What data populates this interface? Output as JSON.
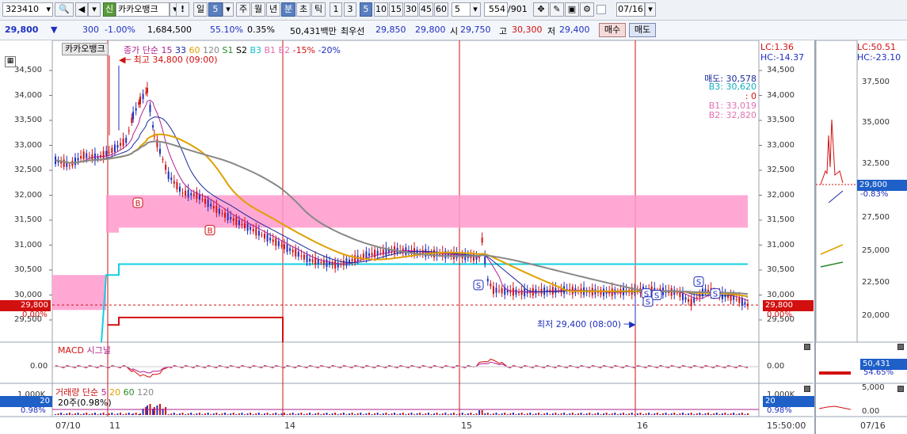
{
  "toolbar": {
    "code": "323410",
    "type_badge": "신",
    "stock_name": "카카오뱅크",
    "warn": "!",
    "period_day": "일",
    "period_value": "5",
    "periods": [
      "주",
      "월",
      "년",
      "분",
      "초",
      "틱"
    ],
    "minutes": [
      "1",
      "3",
      "5",
      "10",
      "15",
      "30",
      "45",
      "60"
    ],
    "count_input": "5",
    "count_display": "554",
    "count_total": "/901",
    "date": "07/16"
  },
  "quote": {
    "price": "29,800",
    "arrow": "▼",
    "change": "300",
    "change_pct": "-1.00%",
    "volume": "1,684,500",
    "vol_ratio": "55.10%",
    "turnover_pct": "0.35%",
    "amount": "50,431백만",
    "best_label": "최우선",
    "bid1": "29,850",
    "bid2": "29,800",
    "open_label": "시",
    "open": "29,750",
    "high_label": "고",
    "high": "30,300",
    "low_label": "저",
    "low": "29,400",
    "buy_btn": "매수",
    "sell_btn": "매도"
  },
  "main_chart": {
    "stock_tag": "카카오뱅크",
    "legend_items": [
      {
        "text": "종가 단순",
        "color": "#b02090"
      },
      {
        "text": "15",
        "color": "#b02090"
      },
      {
        "text": "33",
        "color": "#1a2a9a"
      },
      {
        "text": "60",
        "color": "#e0a000"
      },
      {
        "text": "120",
        "color": "#888888"
      },
      {
        "text": "S1",
        "color": "#2a8a2a"
      },
      {
        "text": "S2",
        "color": "#000000"
      },
      {
        "text": "B3",
        "color": "#10c0d0"
      },
      {
        "text": "B1",
        "color": "#e070b0"
      },
      {
        "text": "B2",
        "color": "#e070b0"
      },
      {
        "text": "-15%",
        "color": "#d21010"
      },
      {
        "text": "-20%",
        "color": "#1e2fbf"
      }
    ],
    "lc_left": "LC:1.36",
    "hc_left": "HC:-14.37",
    "lc_right": "LC:50.51",
    "hc_right": "HC:-23.10",
    "high_note": "최고 34,800 (09:00)",
    "low_note": "최저 29,400 (08:00)",
    "info_lines": [
      {
        "text": "매도: 30,578",
        "color": "#1a2a9a"
      },
      {
        "text": "B3: 30,620",
        "color": "#10b0c0"
      },
      {
        "text": ": 0",
        "color": "#d21010"
      },
      {
        "text": "B1: 33,019",
        "color": "#e070b0"
      },
      {
        "text": "B2: 32,820",
        "color": "#e070b0"
      }
    ],
    "y_labels": [
      "34,500",
      "34,000",
      "33,500",
      "33,000",
      "32,500",
      "32,000",
      "31,500",
      "31,000",
      "30,500",
      "30,000",
      "29,500"
    ],
    "y_labels_right_extra": [
      "34,500",
      "34,000",
      "33,500",
      "33,000",
      "32,500",
      "32,000",
      "31,500",
      "31,000",
      "30,500",
      "30,000",
      "29,500"
    ],
    "current_price_tag": "29,800",
    "current_pct_tag": "0.00%",
    "far_right_y": [
      "37,500",
      "35,000",
      "32,500",
      "27,500",
      "25,000",
      "22,500",
      "20,000"
    ],
    "far_right_price": "29,800",
    "far_right_pct": "-0.83%",
    "buy_marker": "B",
    "sell_marker": "S"
  },
  "macd_pane": {
    "legend_macd": "MACD",
    "legend_signal": "시그널",
    "zero_label": "0.00",
    "zero_label_right": "0.00",
    "right_values": [
      "50,431",
      "54.65%"
    ]
  },
  "volume_pane": {
    "legend_title": "거래량 단순",
    "legend_items": [
      {
        "text": "5",
        "color": "#b02090"
      },
      {
        "text": "20",
        "color": "#e0a000"
      },
      {
        "text": "60",
        "color": "#2a8a2a"
      },
      {
        "text": "120",
        "color": "#888888"
      }
    ],
    "sub_text": "20주(0.98%)",
    "y_top": "1,000K",
    "tag_value": "20",
    "tag_pct": "0.98%",
    "right_y_top": "1,000K",
    "right_tag_value": "20",
    "right_tag_pct": "0.98%",
    "far_right_y": [
      "5,000",
      "0.00"
    ]
  },
  "x_axis": {
    "labels": [
      "07/10",
      "11",
      "14",
      "15",
      "16"
    ],
    "time_label": "15:50:00",
    "far_right_label": "07/16"
  },
  "chart_data": {
    "type": "candlestick",
    "title": "카카오뱅크",
    "x": [
      "07/10",
      "07/11",
      "07/14",
      "07/15",
      "07/16"
    ],
    "y_range": [
      29300,
      34700
    ],
    "high": 34800,
    "low": 29400,
    "last": 29800,
    "trend": [
      [
        0,
        32700
      ],
      [
        10,
        32600
      ],
      [
        20,
        32800
      ],
      [
        30,
        32750
      ],
      [
        40,
        32900
      ],
      [
        50,
        33100
      ],
      [
        55,
        33600
      ],
      [
        60,
        33900
      ],
      [
        65,
        34100
      ],
      [
        70,
        33200
      ],
      [
        80,
        32400
      ],
      [
        90,
        32050
      ],
      [
        100,
        32000
      ],
      [
        110,
        31800
      ],
      [
        120,
        31600
      ],
      [
        130,
        31450
      ],
      [
        140,
        31300
      ],
      [
        160,
        31000
      ],
      [
        180,
        30700
      ],
      [
        200,
        30600
      ],
      [
        220,
        30800
      ],
      [
        240,
        30900
      ],
      [
        260,
        30850
      ],
      [
        280,
        30800
      ],
      [
        300,
        30750
      ],
      [
        302,
        31100
      ],
      [
        306,
        30300
      ],
      [
        310,
        30100
      ],
      [
        330,
        30050
      ],
      [
        360,
        30100
      ],
      [
        390,
        30050
      ],
      [
        420,
        30100
      ],
      [
        440,
        30050
      ],
      [
        450,
        29850
      ],
      [
        460,
        30100
      ],
      [
        470,
        30000
      ],
      [
        480,
        29950
      ],
      [
        490,
        29800
      ]
    ]
  }
}
